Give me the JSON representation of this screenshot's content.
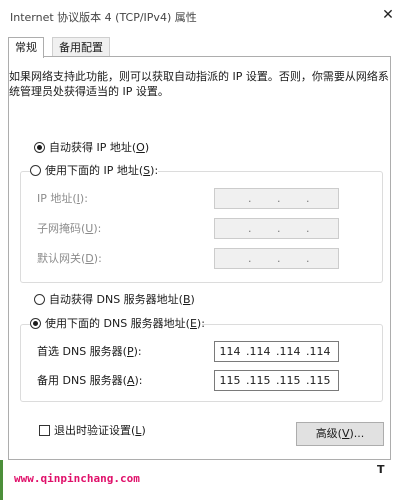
{
  "window": {
    "title": "Internet 协议版本 4 (TCP/IPv4) 属性",
    "close_glyph": "✕"
  },
  "tabs": [
    {
      "label": "常规",
      "active": true
    },
    {
      "label": "备用配置",
      "active": false
    }
  ],
  "description": "如果网络支持此功能，则可以获取自动指派的 IP 设置。否则，你需要从网络系统管理员处获得适当的 IP 设置。",
  "ip": {
    "auto_radio": {
      "label": "自动获得 IP 地址(",
      "key": "O",
      "tail": ")",
      "checked": true
    },
    "manual_radio": {
      "label": "使用下面的 IP 地址(",
      "key": "S",
      "tail": "):",
      "checked": false
    },
    "fields": [
      {
        "label": "IP 地址(",
        "key": "I",
        "tail": "):",
        "value": [
          "",
          "",
          "",
          ""
        ]
      },
      {
        "label": "子网掩码(",
        "key": "U",
        "tail": "):",
        "value": [
          "",
          "",
          "",
          ""
        ]
      },
      {
        "label": "默认网关(",
        "key": "D",
        "tail": "):",
        "value": [
          "",
          "",
          "",
          ""
        ]
      }
    ]
  },
  "dns": {
    "auto_radio": {
      "label": "自动获得 DNS 服务器地址(",
      "key": "B",
      "tail": ")",
      "checked": false
    },
    "manual_radio": {
      "label": "使用下面的 DNS 服务器地址(",
      "key": "E",
      "tail": "):",
      "checked": true
    },
    "fields": [
      {
        "label": "首选 DNS 服务器(",
        "key": "P",
        "tail": "):",
        "value": [
          "114",
          "114",
          "114",
          "114"
        ]
      },
      {
        "label": "备用 DNS 服务器(",
        "key": "A",
        "tail": "):",
        "value": [
          "115",
          "115",
          "115",
          "115"
        ]
      }
    ]
  },
  "validate_checkbox": {
    "label": "退出时验证设置(",
    "key": "L",
    "tail": ")",
    "checked": false
  },
  "advanced_button": {
    "label": "高级(",
    "key": "V",
    "tail": ")..."
  },
  "footer": {
    "url": "www.qinpinchang.com",
    "fragment": "T"
  }
}
